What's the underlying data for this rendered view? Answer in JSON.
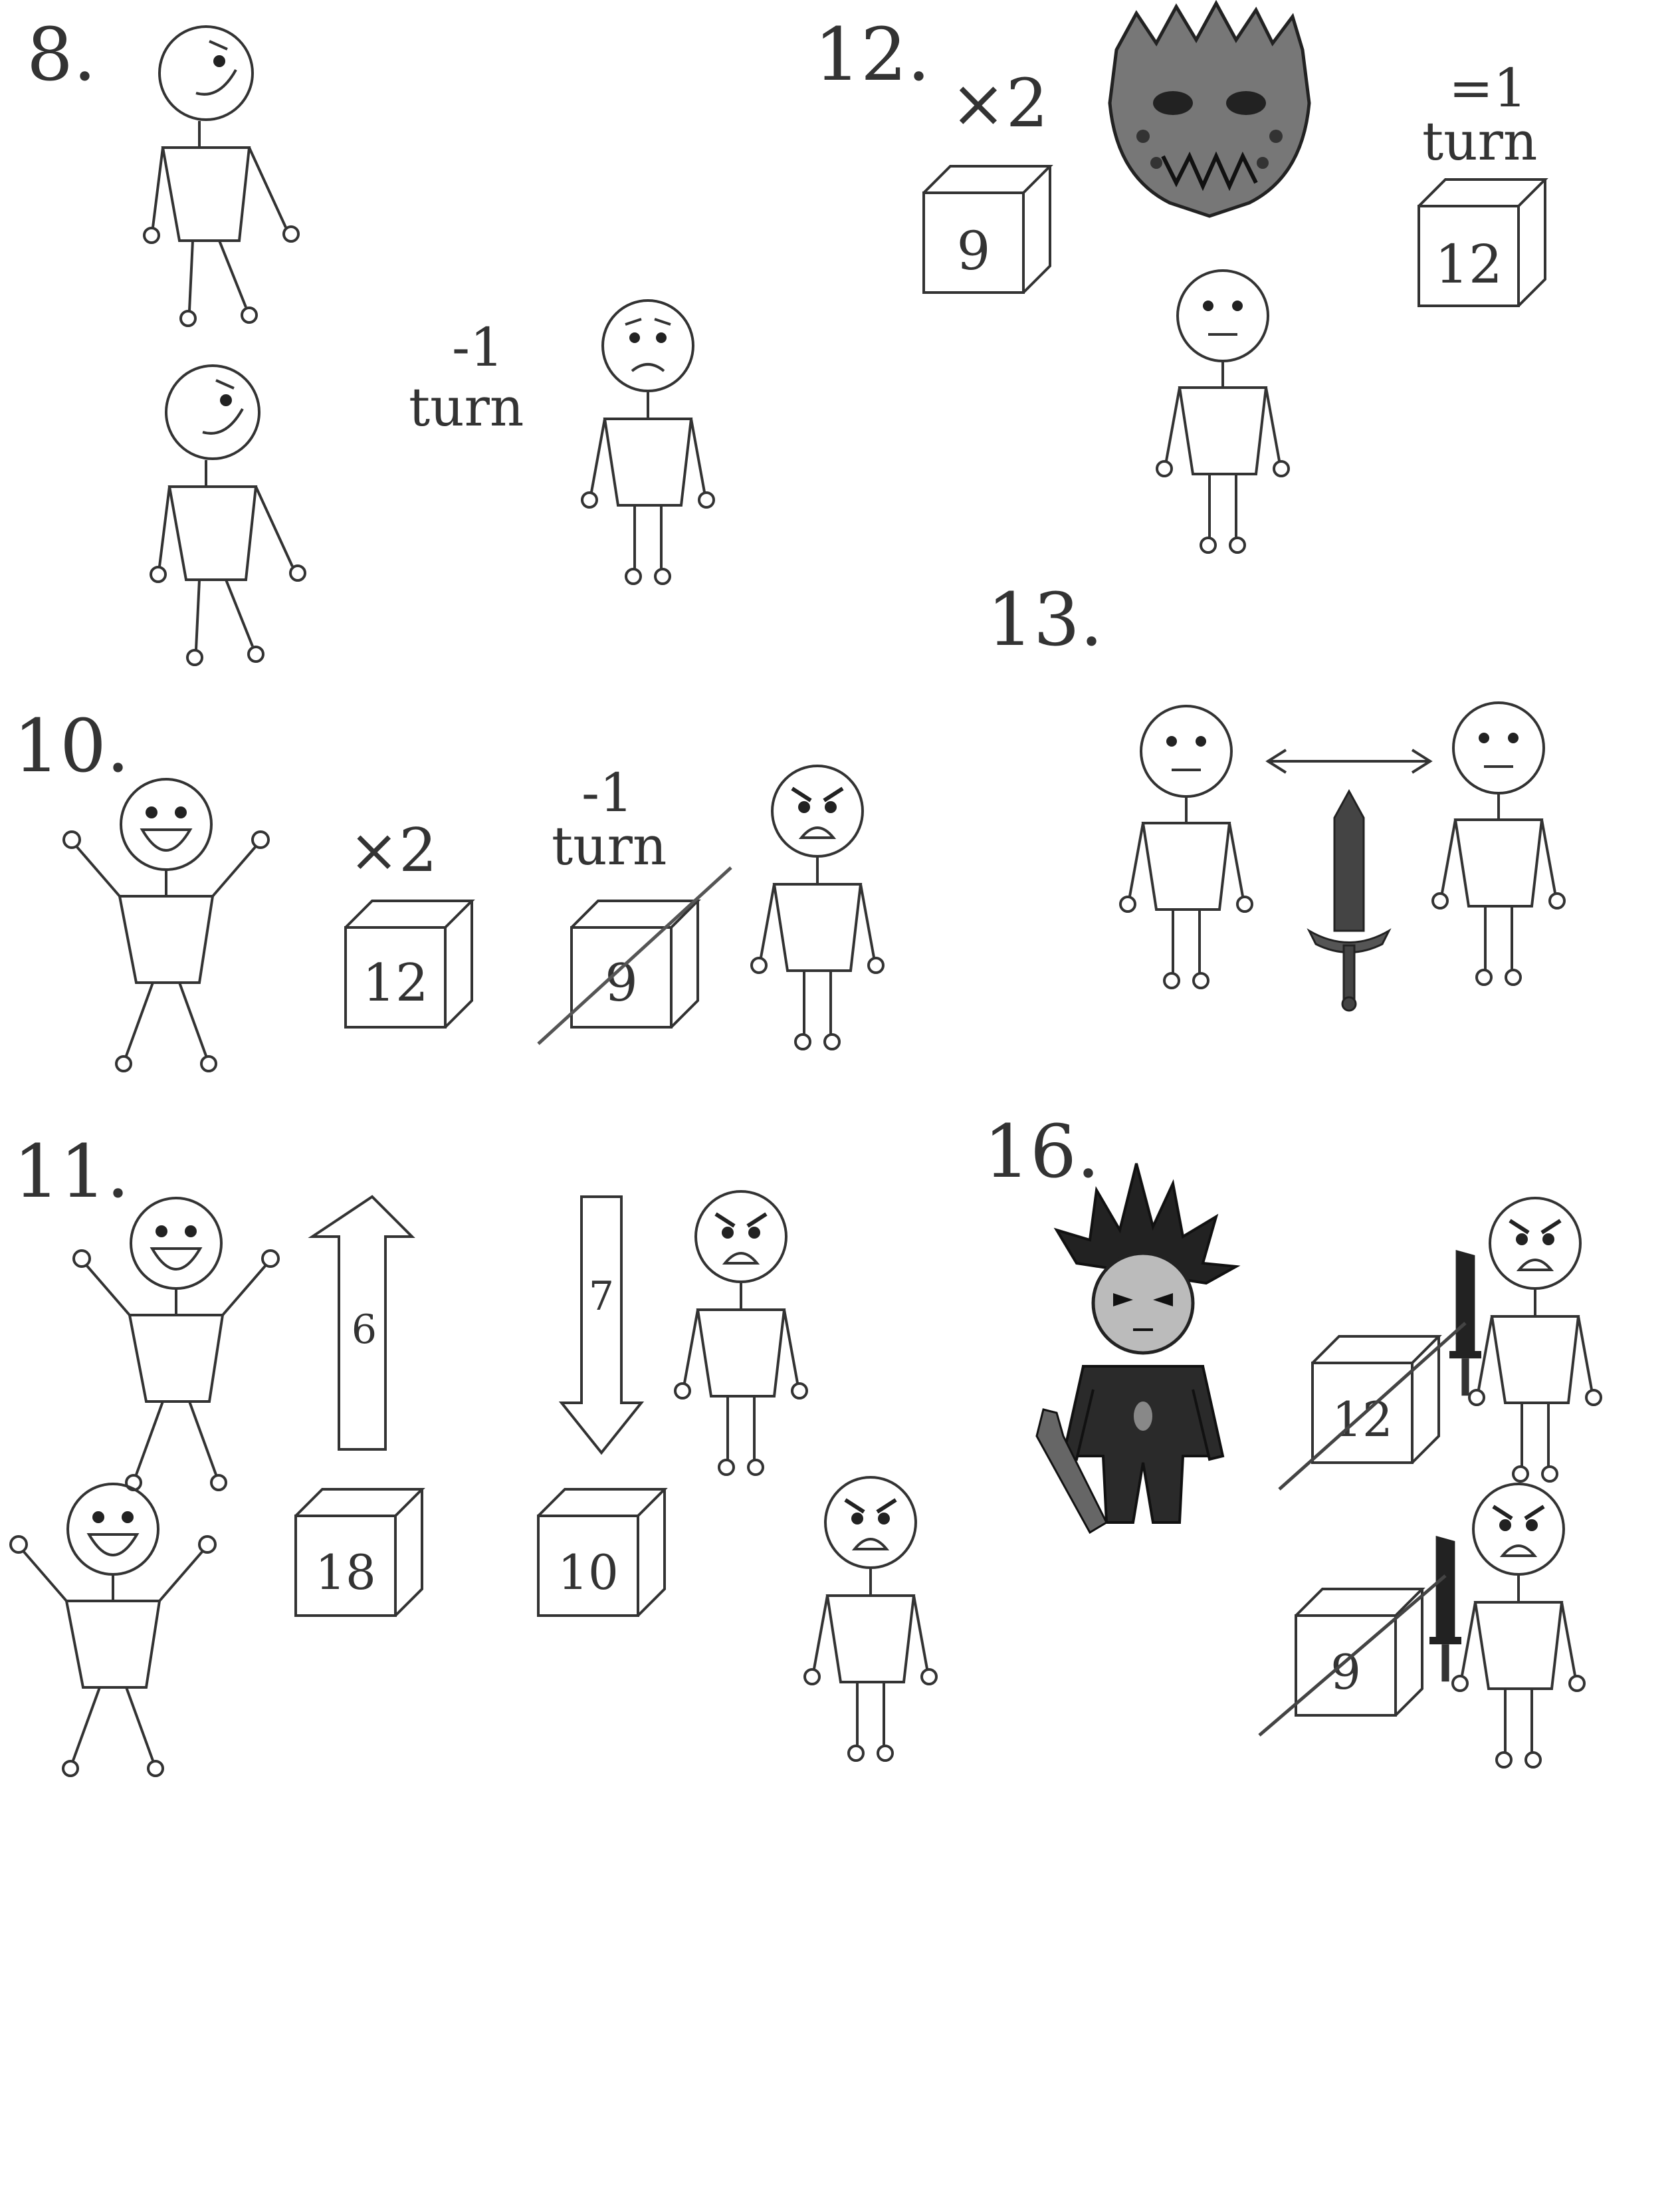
{
  "page": {
    "paper_color": "#ffffff",
    "ink_color": "#333333"
  },
  "panels": [
    {
      "number_label": "8.",
      "annotations": {
        "turn_minus": "-1",
        "turn_word": "turn"
      },
      "figures": [
        "smiling-walking-stick-figure",
        "smiling-walking-stick-figure",
        "sad-stick-figure"
      ]
    },
    {
      "number_label": "12.",
      "annotations": {
        "multiplier": "×2",
        "turn_minus": "=1",
        "turn_word": "turn"
      },
      "boxes": [
        {
          "value": "9"
        },
        {
          "value": "12"
        }
      ],
      "figures": [
        "spiky-monster-head",
        "neutral-stick-figure"
      ]
    },
    {
      "number_label": "10.",
      "annotations": {
        "multiplier": "×2",
        "turn_minus": "-1",
        "turn_word": "turn"
      },
      "boxes": [
        {
          "value": "12"
        },
        {
          "value": "9",
          "crossed_out": true
        }
      ],
      "figures": [
        "cheering-stick-figure",
        "angry-stick-figure"
      ]
    },
    {
      "number_label": "13.",
      "figures": [
        "neutral-stick-figure",
        "double-arrow",
        "sword",
        "neutral-stick-figure"
      ]
    },
    {
      "number_label": "11.",
      "arrows": [
        {
          "direction": "up",
          "value": "6"
        },
        {
          "direction": "down",
          "value": "7"
        }
      ],
      "boxes": [
        {
          "value": "18"
        },
        {
          "value": "10"
        }
      ],
      "figures": [
        "cheering-stick-figure",
        "cheering-stick-figure",
        "angry-stick-figure",
        "angry-stick-figure"
      ]
    },
    {
      "number_label": "16.",
      "boxes": [
        {
          "value": "12",
          "crossed_out": true
        },
        {
          "value": "9",
          "crossed_out": true
        }
      ],
      "figures": [
        "spiky-haired-warrior",
        "angry-stick-figure-with-sword",
        "angry-stick-figure-with-sword"
      ]
    }
  ]
}
